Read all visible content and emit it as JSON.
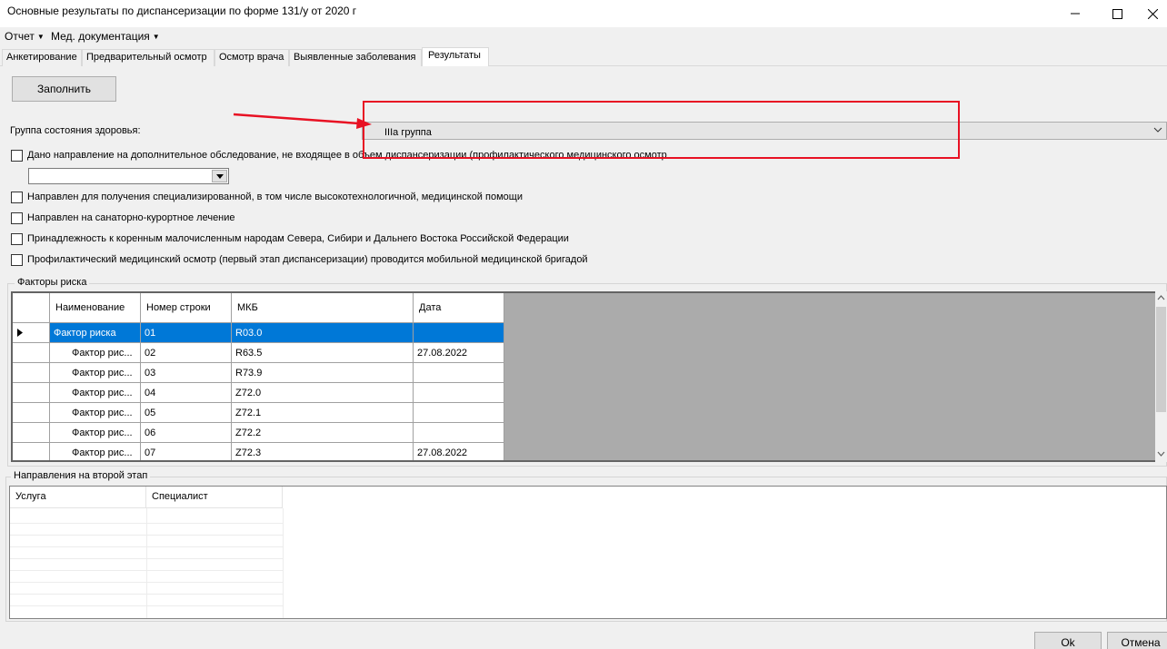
{
  "window": {
    "title": "Основные результаты по диспансеризации по форме 131/у от 2020 г"
  },
  "menu": {
    "items": [
      {
        "label": "Отчет"
      },
      {
        "label": "Мед. документация"
      }
    ]
  },
  "tabs": [
    {
      "label": "Анкетирование",
      "active": false
    },
    {
      "label": "Предварительный осмотр",
      "active": false
    },
    {
      "label": "Осмотр врача",
      "active": false
    },
    {
      "label": "Выявленные заболевания",
      "active": false
    },
    {
      "label": "Результаты",
      "active": true
    }
  ],
  "results": {
    "fill_button": "Заполнить",
    "health_group_label": "Группа состояния здоровья:",
    "health_group_value": "IIIa группа",
    "extra_exam_label": "Дано направление на дополнительное обследование, не входящее в объем диспансеризации (профилактического медицинского осмотр",
    "extra_exam_value": "",
    "checkboxes": [
      {
        "label": "Направлен для получения специализированной, в том числе высокотехнологичной, медицинской помощи",
        "checked": false
      },
      {
        "label": "Направлен на санаторно-курортное лечение",
        "checked": false
      },
      {
        "label": "Принадлежность к коренным малочисленным народам Севера, Сибири и Дальнего Востока Российской Федерации",
        "checked": false
      },
      {
        "label": "Профилактический медицинский осмотр (первый этап диспансеризации) проводится мобильной медицинской бригадой",
        "checked": false
      }
    ]
  },
  "risk_factors": {
    "title": "Факторы риска",
    "columns": [
      "Наименование",
      "Номер строки",
      "МКБ",
      "Дата"
    ],
    "rows": [
      {
        "name": "Фактор риска",
        "num": "01",
        "mkb": "R03.0",
        "date": "",
        "selected": true
      },
      {
        "name": "Фактор рис...",
        "num": "02",
        "mkb": "R63.5",
        "date": "27.08.2022"
      },
      {
        "name": "Фактор рис...",
        "num": "03",
        "mkb": "R73.9",
        "date": ""
      },
      {
        "name": "Фактор рис...",
        "num": "04",
        "mkb": "Z72.0",
        "date": ""
      },
      {
        "name": "Фактор рис...",
        "num": "05",
        "mkb": "Z72.1",
        "date": ""
      },
      {
        "name": "Фактор рис...",
        "num": "06",
        "mkb": "Z72.2",
        "date": ""
      },
      {
        "name": "Фактор рис...",
        "num": "07",
        "mkb": "Z72.3",
        "date": "27.08.2022"
      }
    ]
  },
  "second_stage": {
    "title": "Направления на второй этап",
    "columns": [
      "Услуга",
      "Специалист"
    ]
  },
  "footer": {
    "ok": "Ok",
    "cancel": "Отмена"
  },
  "annotation": {
    "color": "#e81123"
  }
}
